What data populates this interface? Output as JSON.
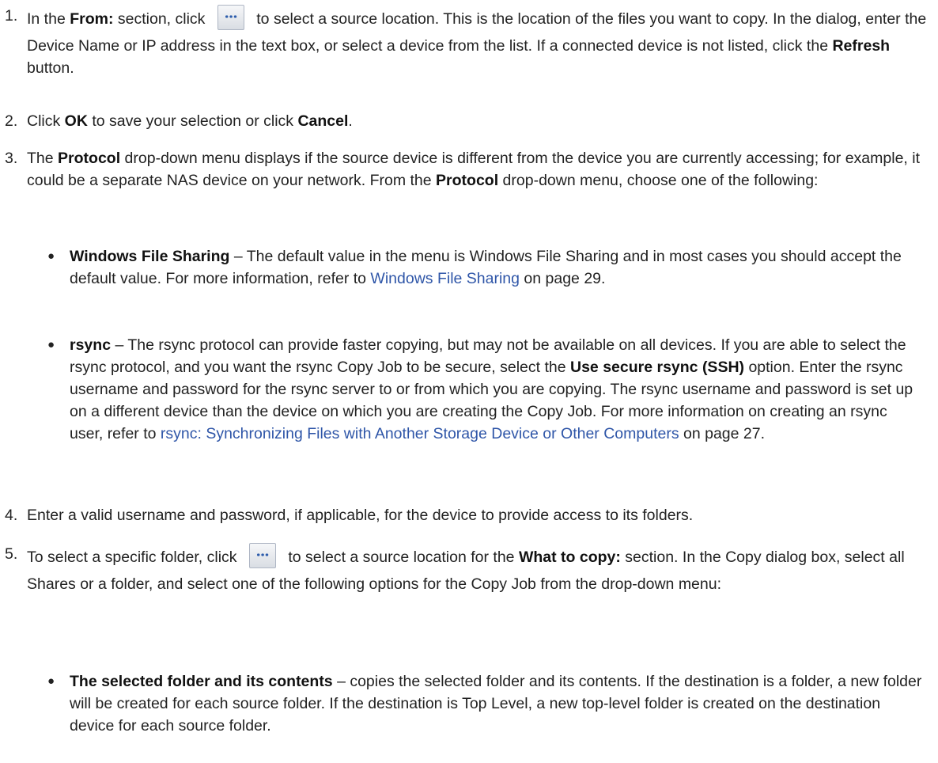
{
  "steps": [
    {
      "number": "1.",
      "pre": "In the ",
      "b1": "From:",
      "mid1": " section, click ",
      "icon": "ellipsis-browse-icon",
      "mid2": " to select a source location. This is the location of the files you want to copy. In the dialog, enter the Device Name or IP address in the text box, or select a device from the list. If a connected device is not listed, click the ",
      "b2": "Refresh",
      "post": " button."
    },
    {
      "number": "2.",
      "pre": "Click ",
      "b1": "OK",
      "mid1": " to save your selection or click ",
      "b2": "Cancel",
      "post": "."
    },
    {
      "number": "3.",
      "pre": "The ",
      "b1": "Protocol",
      "mid1": " drop-down menu displays if the source device is different from the device you are currently accessing; for example, it could be a separate NAS device on your network. From the ",
      "b2": "Protocol",
      "post": " drop-down menu, choose one of the following:"
    },
    {
      "number": "4.",
      "text": "Enter a valid username and password, if applicable, for the device to provide access to its folders."
    },
    {
      "number": "5.",
      "pre": "To select a specific folder, click ",
      "icon": "ellipsis-browse-icon",
      "mid1": " to select a source location for the ",
      "b1": "What to copy:",
      "post": " section. In the Copy dialog box, select all Shares or a folder, and select one of the following options for the Copy Job from the drop-down menu:"
    }
  ],
  "bullets": [
    {
      "title": "Windows File Sharing",
      "text": " – The default value in the menu is Windows File Sharing and in most cases you should accept the default value. For more information, refer to ",
      "link": "Windows File Sharing",
      "after": " on page 29."
    },
    {
      "title": "rsync",
      "text": " – The rsync protocol can provide faster copying, but may not be available on all devices. If you are able to select the rsync protocol, and you want the rsync Copy Job to be secure, select the ",
      "b": "Use secure rsync (SSH)",
      "text2": " option. Enter the rsync username and password for the rsync server to or from which you are copying. The rsync username and password is set up on a different device than the device on which you are creating the Copy Job. For more information on creating an rsync user, refer to ",
      "link": "rsync: Synchronizing Files with Another Storage Device or Other Computers",
      "after": " on page 27."
    },
    {
      "title": "The selected folder and its contents",
      "text": " – copies the selected folder and its contents. If the destination is a folder, a new folder will be created for each source folder. If the destination is Top Level, a new top-level folder is created on the destination device for each source folder."
    }
  ]
}
